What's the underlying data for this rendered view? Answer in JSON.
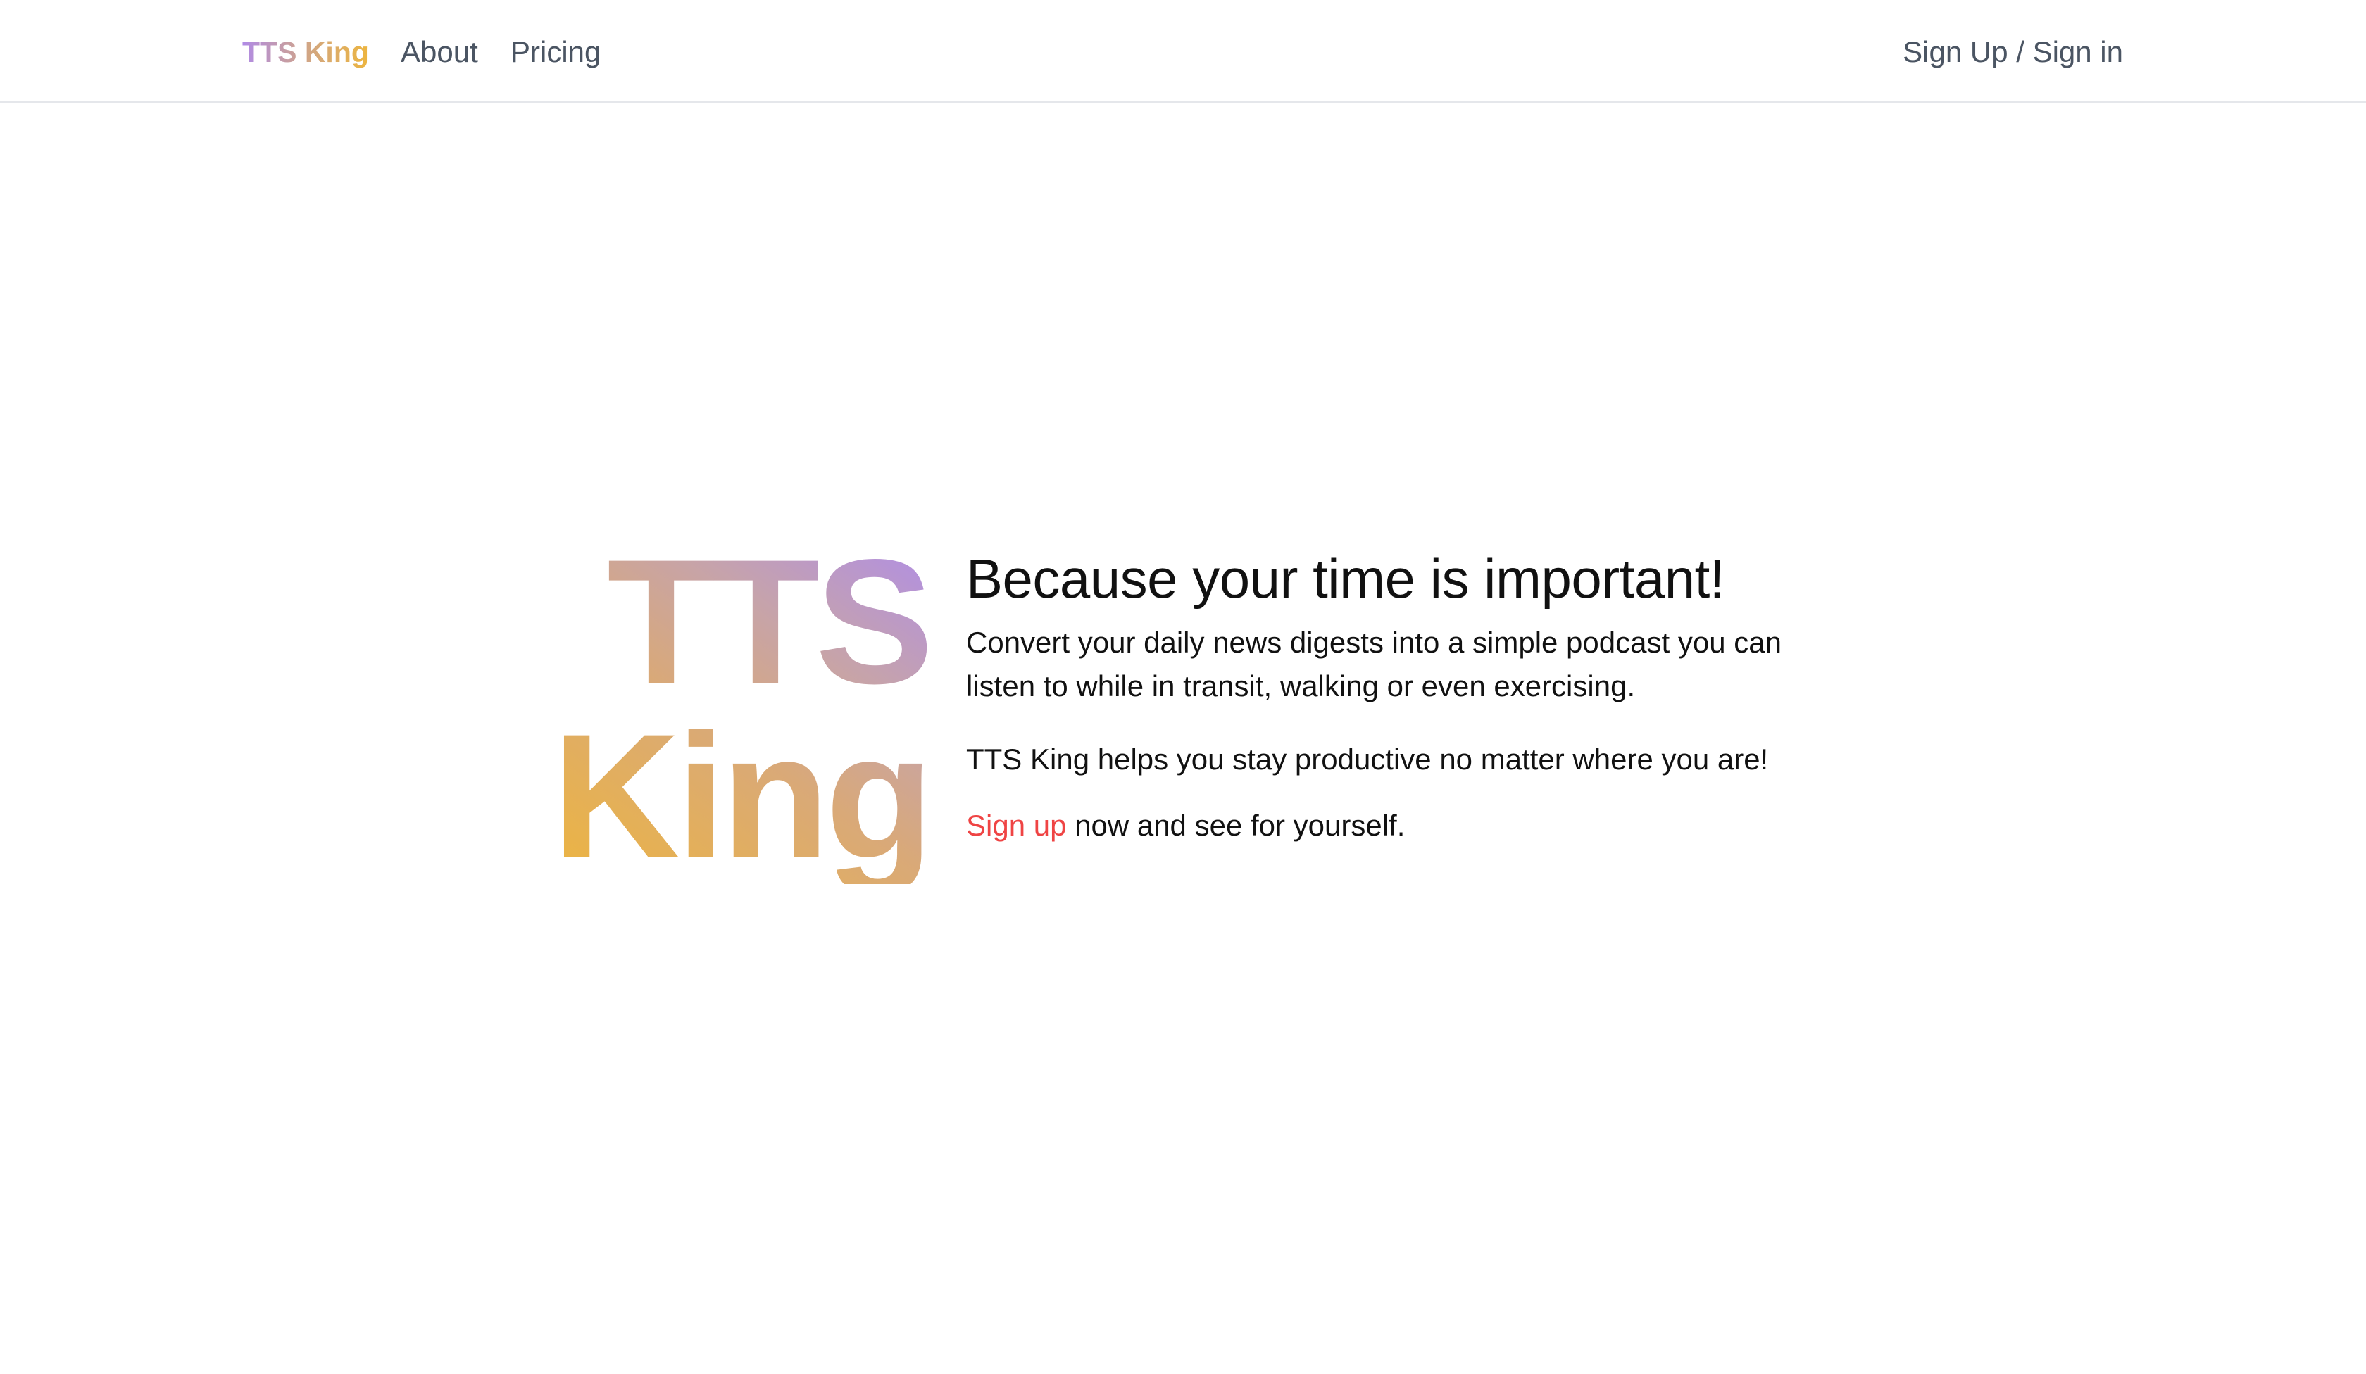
{
  "nav": {
    "brand": "TTS King",
    "links": [
      "About",
      "Pricing"
    ],
    "auth_label": "Sign Up / Sign in"
  },
  "hero": {
    "logo_line1": "TTS",
    "logo_line2": "King",
    "title": "Because your time is important!",
    "paragraph1": "Convert your daily news digests into a simple podcast you can listen to while in transit, walking or even exercising.",
    "paragraph2": "TTS King helps you stay productive no matter where you are!",
    "cta_link": "Sign up",
    "cta_rest": " now and see for yourself."
  },
  "colors": {
    "accent_link": "#ef4444",
    "gradient_purple": "#af8de8",
    "gradient_gold": "#edb53f",
    "nav_text": "#4b5563"
  }
}
